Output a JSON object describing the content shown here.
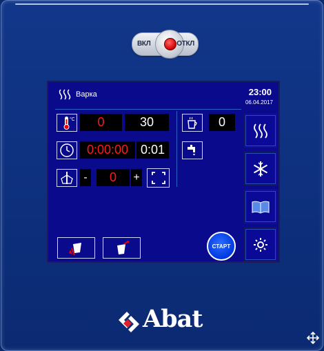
{
  "power_switch": {
    "on_label": "ВКЛ",
    "off_label": "ОТКЛ"
  },
  "header": {
    "mode_label": "Варка",
    "time": "23:00",
    "date": "06.04.2017"
  },
  "temperature": {
    "actual": "0",
    "setpoint": "30"
  },
  "timer": {
    "elapsed": "0:00:00",
    "set": "0:01"
  },
  "core_probe": {
    "minus_label": "-",
    "value": "0",
    "plus_label": "+"
  },
  "humidity": {
    "value": "0"
  },
  "start_button": {
    "label": "СТАРТ"
  },
  "logo": {
    "brand": "Abat"
  },
  "colors": {
    "background": "#0d2f7c",
    "screen": "#0a0a8c",
    "red_value": "#ff1a1a",
    "start": "#0038e0"
  },
  "icons": [
    "steam-icon",
    "thermometer-icon",
    "clock-icon",
    "probe-icon",
    "expand-icon",
    "cup-icon",
    "faucet-icon",
    "snowflake-icon",
    "book-icon",
    "gear-icon",
    "pour-out-icon",
    "pour-in-icon"
  ]
}
